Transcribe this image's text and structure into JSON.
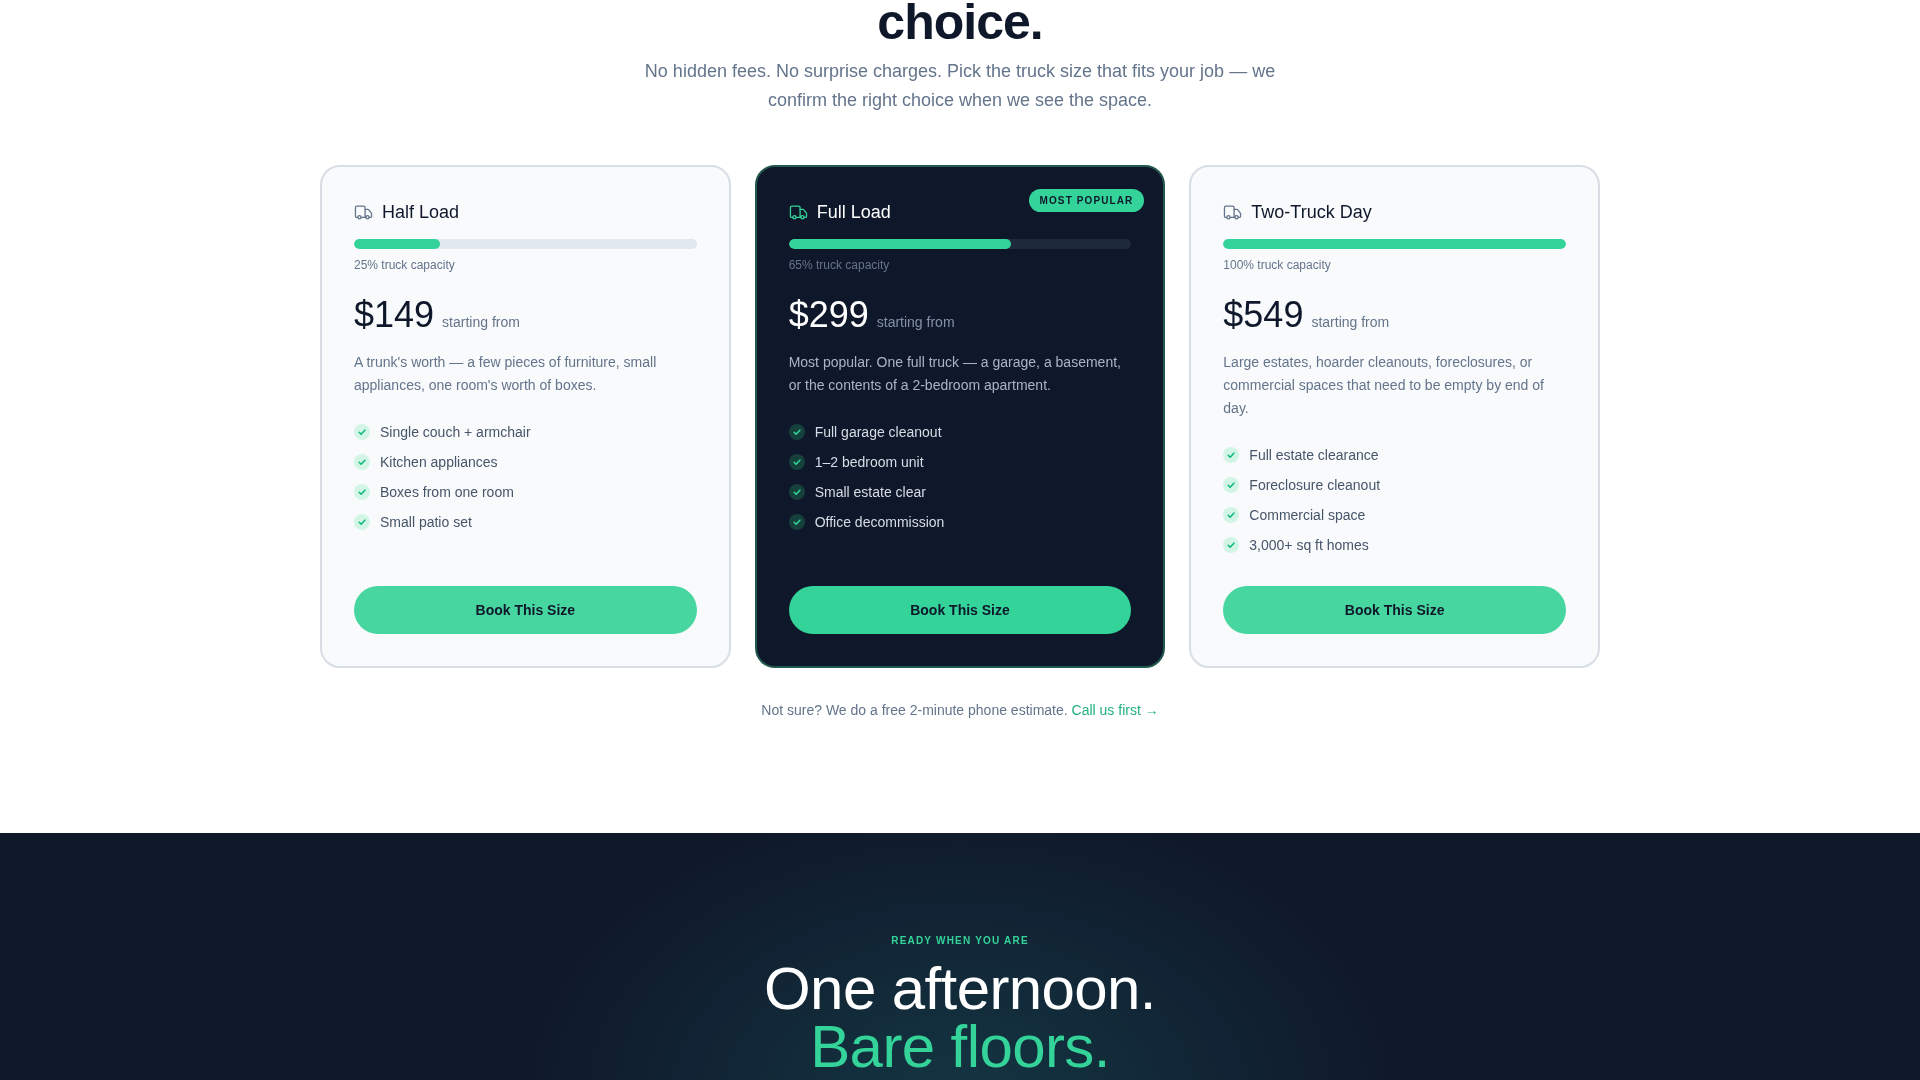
{
  "heading": "choice.",
  "subtitle": "No hidden fees. No surprise charges. Pick the truck size that fits your job — we confirm the right choice when we see the space.",
  "plans": [
    {
      "name": "Half Load",
      "featured": false,
      "capacity": {
        "level": 0.25,
        "label": "25% truck capacity"
      },
      "price": "$149",
      "price_note": "starting from",
      "description": "A trunk's worth — a few pieces of furniture, small appliances, one room's worth of boxes.",
      "features": [
        "Single couch + armchair",
        "Kitchen appliances",
        "Boxes from one room",
        "Small patio set"
      ],
      "button": "Book This Size"
    },
    {
      "name": "Full Load",
      "featured": true,
      "badge": "MOST POPULAR",
      "capacity": {
        "level": 0.65,
        "label": "65% truck capacity"
      },
      "price": "$299",
      "price_note": "starting from",
      "description": "Most popular. One full truck — a garage, a basement, or the contents of a 2-bedroom apartment.",
      "features": [
        "Full garage cleanout",
        "1–2 bedroom unit",
        "Small estate clear",
        "Office decommission"
      ],
      "button": "Book This Size"
    },
    {
      "name": "Two-Truck Day",
      "featured": false,
      "capacity": {
        "level": 1,
        "label": "100% truck capacity"
      },
      "price": "$549",
      "price_note": "starting from",
      "description": "Large estates, hoarder cleanouts, foreclosures, or commercial spaces that need to be empty by end of day.",
      "features": [
        "Full estate clearance",
        "Foreclosure cleanout",
        "Commercial space",
        "3,000+ sq ft homes"
      ],
      "button": "Book This Size"
    }
  ],
  "note": {
    "text": "Not sure? We do a free 2-minute phone estimate.",
    "link": "Call us first →"
  },
  "cta": {
    "eyebrow": "READY WHEN YOU ARE",
    "title": "One afternoon.",
    "title_accent": "Bare floors."
  }
}
